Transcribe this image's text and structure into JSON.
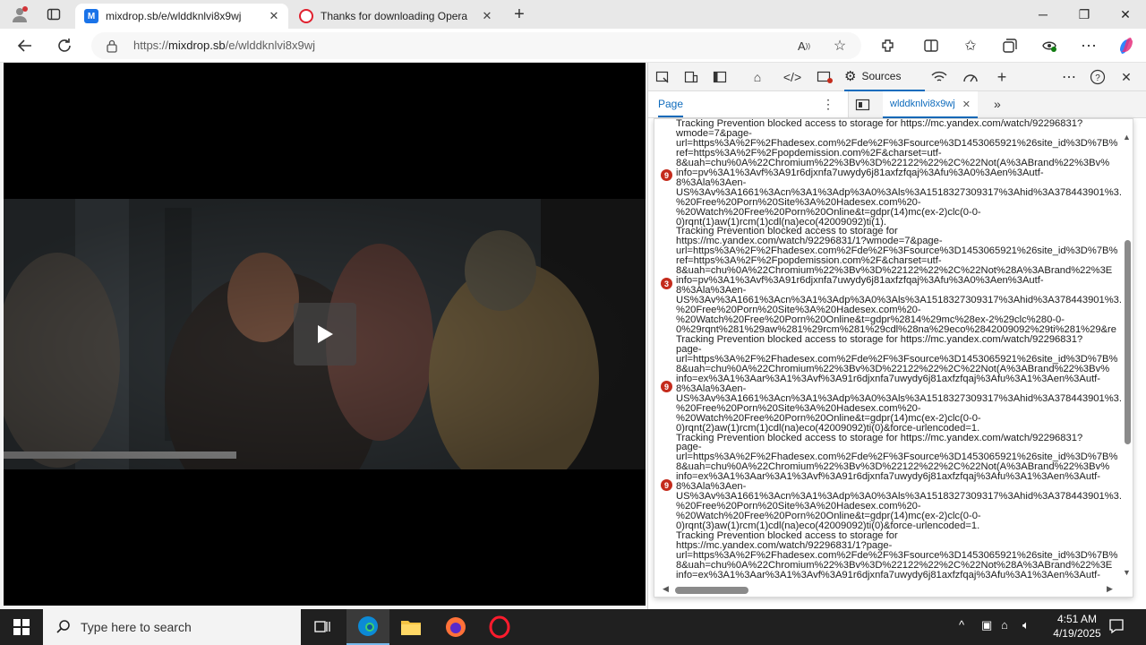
{
  "browser": {
    "tabs": [
      {
        "label": "mixdrop.sb/e/wlddknlvi8x9wj",
        "icon": "mixdrop-favicon",
        "active": true
      },
      {
        "label": "Thanks for downloading Opera",
        "icon": "opera-favicon",
        "active": false
      }
    ],
    "new_tab": "+",
    "window": {
      "minimize": "─",
      "maximize": "❐",
      "close": "✕"
    },
    "url_scheme": "https://",
    "url_host": "mixdrop.sb",
    "url_path": "/e/wlddknlvi8x9wj"
  },
  "devtools": {
    "sources_label": "Sources",
    "page_tab": "Page",
    "file_tab": "wlddknlvi8x9wj",
    "badges": [
      "9",
      "3",
      "9",
      "9"
    ]
  },
  "console_lines": [
    "Tracking Prevention blocked access to storage for https://mc.yandex.com/watch/92296831?",
    "wmode=7&page-",
    "url=https%3A%2F%2Fhadesex.com%2Fde%2F%3Fsource%3D1453065921%26site_id%3D%7B%",
    "ref=https%3A%2F%2Fpopdemission.com%2F&charset=utf-",
    "8&uah=chu%0A%22Chromium%22%3Bv%3D%22122%22%2C%22Not(A%3ABrand%22%3Bv%",
    "info=pv%3A1%3Avf%3A91r6djxnfa7uwydy6j81axfzfqaj%3Afu%3A0%3Aen%3Autf-",
    "8%3Ala%3Aen-",
    "US%3Av%3A1661%3Acn%3A1%3Adp%3A0%3Als%3A1518327309317%3Ahid%3A378443901%3.",
    "%20Free%20Porn%20Site%3A%20Hadesex.com%20-",
    "%20Watch%20Free%20Porn%20Online&t=gdpr(14)mc(ex-2)clc(0-0-",
    "0)rqnt(1)aw(1)rcm(1)cdl(na)eco(42009092)ti(1).",
    "Tracking Prevention blocked access to storage for",
    "https://mc.yandex.com/watch/92296831/1?wmode=7&page-",
    "url=https%3A%2F%2Fhadesex.com%2Fde%2F%3Fsource%3D1453065921%26site_id%3D%7B%",
    "ref=https%3A%2F%2Fpopdemission.com%2F&charset=utf-",
    "8&uah=chu%0A%22Chromium%22%3Bv%3D%22122%22%2C%22Not%28A%3ABrand%22%3E",
    "info=pv%3A1%3Avf%3A91r6djxnfa7uwydy6j81axfzfqaj%3Afu%3A0%3Aen%3Autf-",
    "8%3Ala%3Aen-",
    "US%3Av%3A1661%3Acn%3A1%3Adp%3A0%3Als%3A1518327309317%3Ahid%3A378443901%3.",
    "%20Free%20Porn%20Site%3A%20Hadesex.com%20-",
    "%20Watch%20Free%20Porn%20Online&t=gdpr%2814%29mc%28ex-2%29clc%280-0-",
    "0%29rqnt%281%29aw%281%29rcm%281%29cdl%28na%29eco%2842009092%29ti%281%29&re",
    "Tracking Prevention blocked access to storage for https://mc.yandex.com/watch/92296831?",
    "page-",
    "url=https%3A%2F%2Fhadesex.com%2Fde%2F%3Fsource%3D1453065921%26site_id%3D%7B%",
    "8&uah=chu%0A%22Chromium%22%3Bv%3D%22122%22%2C%22Not(A%3ABrand%22%3Bv%",
    "info=ex%3A1%3Aar%3A1%3Avf%3A91r6djxnfa7uwydy6j81axfzfqaj%3Afu%3A1%3Aen%3Autf-",
    "8%3Ala%3Aen-",
    "US%3Av%3A1661%3Acn%3A1%3Adp%3A0%3Als%3A1518327309317%3Ahid%3A378443901%3.",
    "%20Free%20Porn%20Site%3A%20Hadesex.com%20-",
    "%20Watch%20Free%20Porn%20Online&t=gdpr(14)mc(ex-2)clc(0-0-",
    "0)rqnt(2)aw(1)rcm(1)cdl(na)eco(42009092)ti(0)&force-urlencoded=1.",
    "Tracking Prevention blocked access to storage for https://mc.yandex.com/watch/92296831?",
    "page-",
    "url=https%3A%2F%2Fhadesex.com%2Fde%2F%3Fsource%3D1453065921%26site_id%3D%7B%",
    "8&uah=chu%0A%22Chromium%22%3Bv%3D%22122%22%2C%22Not(A%3ABrand%22%3Bv%",
    "info=ex%3A1%3Aar%3A1%3Avf%3A91r6djxnfa7uwydy6j81axfzfqaj%3Afu%3A1%3Aen%3Autf-",
    "8%3Ala%3Aen-",
    "US%3Av%3A1661%3Acn%3A1%3Adp%3A0%3Als%3A1518327309317%3Ahid%3A378443901%3.",
    "%20Free%20Porn%20Site%3A%20Hadesex.com%20-",
    "%20Watch%20Free%20Porn%20Online&t=gdpr(14)mc(ex-2)clc(0-0-",
    "0)rqnt(3)aw(1)rcm(1)cdl(na)eco(42009092)ti(0)&force-urlencoded=1.",
    "Tracking Prevention blocked access to storage for",
    "https://mc.yandex.com/watch/92296831/1?page-",
    "url=https%3A%2F%2Fhadesex.com%2Fde%2F%3Fsource%3D1453065921%26site_id%3D%7B%",
    "8&uah=chu%0A%22Chromium%22%3Bv%3D%22122%22%2C%22Not%28A%3ABrand%22%3E",
    "info=ex%3A1%3Aar%3A1%3Avf%3A91r6djxnfa7uwydy6j81axfzfqaj%3Afu%3A1%3Aen%3Autf-"
  ],
  "taskbar": {
    "search_placeholder": "Type here to search",
    "time": "4:51 AM",
    "date": "4/19/2025"
  },
  "colors": {
    "accent": "#0f6cbd",
    "error_badge": "#c42b1c",
    "taskbar": "#202020"
  }
}
